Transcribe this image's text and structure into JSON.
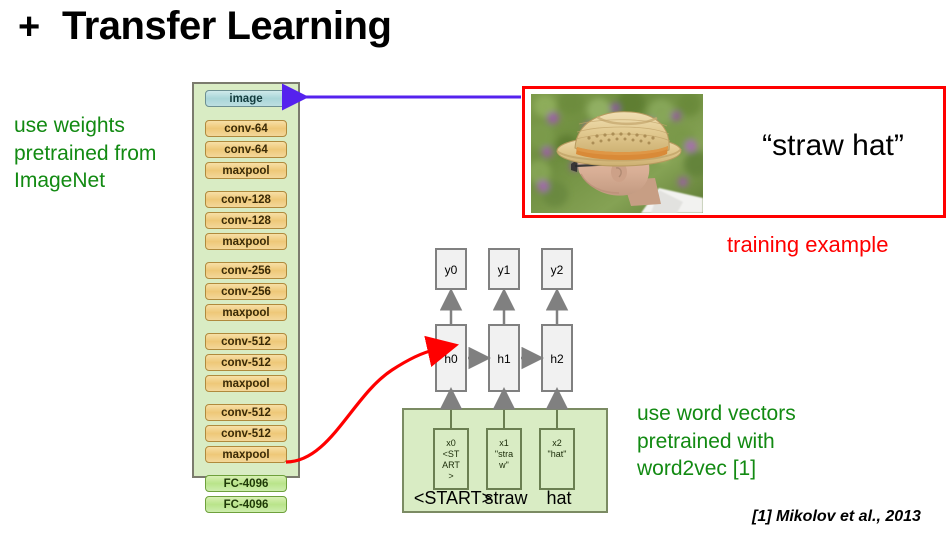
{
  "slide": {
    "bullet": "+",
    "title": "Transfer Learning"
  },
  "left_note": {
    "line1": "use weights",
    "line2": "pretrained from",
    "line3": "ImageNet",
    "color": "#128a12"
  },
  "cnn_stack": {
    "layers": [
      {
        "label": "image",
        "kind": "image"
      },
      {
        "label": "conv-64",
        "kind": "conv"
      },
      {
        "label": "conv-64",
        "kind": "conv"
      },
      {
        "label": "maxpool",
        "kind": "conv",
        "gap": true
      },
      {
        "label": "conv-128",
        "kind": "conv"
      },
      {
        "label": "conv-128",
        "kind": "conv"
      },
      {
        "label": "maxpool",
        "kind": "conv",
        "gap": true
      },
      {
        "label": "conv-256",
        "kind": "conv"
      },
      {
        "label": "conv-256",
        "kind": "conv"
      },
      {
        "label": "maxpool",
        "kind": "conv",
        "gap": true
      },
      {
        "label": "conv-512",
        "kind": "conv"
      },
      {
        "label": "conv-512",
        "kind": "conv"
      },
      {
        "label": "maxpool",
        "kind": "conv",
        "gap": true
      },
      {
        "label": "conv-512",
        "kind": "conv"
      },
      {
        "label": "conv-512",
        "kind": "conv"
      },
      {
        "label": "maxpool",
        "kind": "conv",
        "gap": true
      },
      {
        "label": "FC-4096",
        "kind": "fc"
      },
      {
        "label": "FC-4096",
        "kind": "fc"
      }
    ]
  },
  "training_example": {
    "caption": "“straw hat”",
    "label": "training example",
    "label_color": "#ff0000",
    "box_color": "#ff0000",
    "photo_alt": "photo of a man in profile wearing a straw hat in front of green foliage with purple flowers"
  },
  "rnn": {
    "outputs": [
      {
        "label": "y0"
      },
      {
        "label": "y1"
      },
      {
        "label": "y2"
      }
    ],
    "hidden": [
      {
        "label": "h0"
      },
      {
        "label": "h1"
      },
      {
        "label": "h2"
      }
    ],
    "inputs": [
      {
        "lines": [
          "x0",
          "<ST",
          "ART",
          ">"
        ],
        "word": "<START>"
      },
      {
        "lines": [
          "x1",
          "\"stra",
          "w\""
        ],
        "word": "straw"
      },
      {
        "lines": [
          "x2",
          "\"hat\""
        ],
        "word": "hat"
      }
    ]
  },
  "right_note": {
    "line1": "use word vectors",
    "line2": "pretrained with",
    "line3": "word2vec [1]",
    "color": "#128a12"
  },
  "citation": {
    "text": "[1] Mikolov et al., 2013"
  },
  "arrows": {
    "image_arrow_color": "#5522ee",
    "transfer_arrow_color": "#ff0000",
    "rnn_arrow_color": "#808080"
  }
}
